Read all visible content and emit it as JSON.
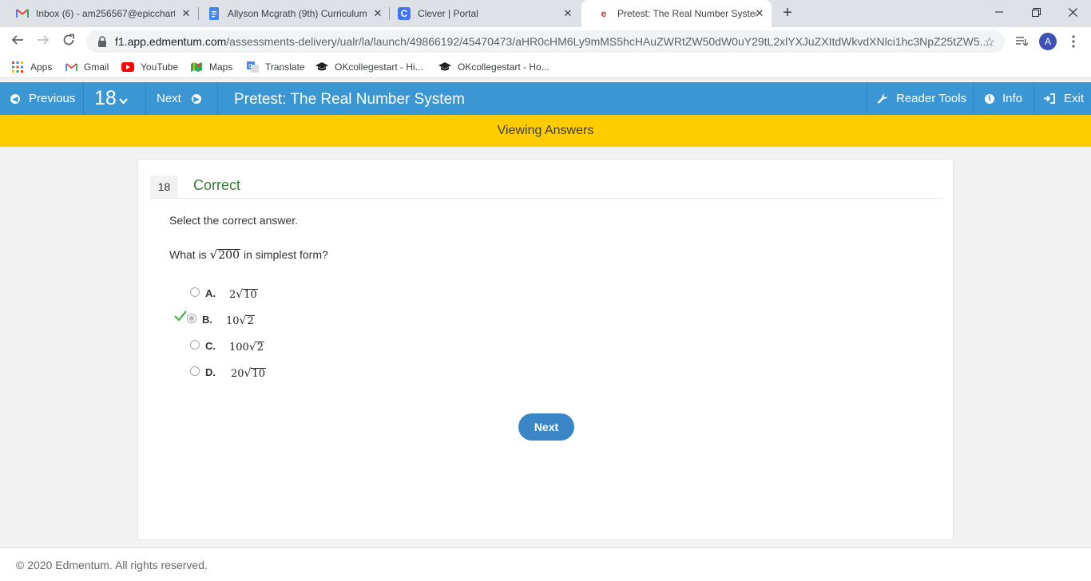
{
  "browser": {
    "tabs": [
      {
        "title": "Inbox (6) - am256567@epiccharte",
        "icon": "gmail-icon"
      },
      {
        "title": "Allyson Mcgrath (9th) Curriculum",
        "icon": "docs-icon"
      },
      {
        "title": "Clever | Portal",
        "icon": "clever-icon"
      },
      {
        "title": "Pretest: The Real Number System",
        "icon": "edmentum-icon",
        "active": true
      }
    ],
    "url_host": "f1.app.edmentum.com",
    "url_path": "/assessments-delivery/ualr/la/launch/49866192/45470473/aHR0cHM6Ly9mMS5hcHAuZWRtZW50dW0uY29tL2xlYXJuZXItdWkvdXNlci1hc3NpZ25tZW5...",
    "profile_initial": "A",
    "bookmarks": [
      "Apps",
      "Gmail",
      "YouTube",
      "Maps",
      "Translate",
      "OKcollegestart - Hi...",
      "OKcollegestart - Ho..."
    ]
  },
  "header": {
    "previous_label": "Previous",
    "question_number": "18",
    "next_label": "Next",
    "title": "Pretest: The Real Number System",
    "reader_tools_label": "Reader Tools",
    "info_label": "Info",
    "exit_label": "Exit"
  },
  "banner": "Viewing Answers",
  "question": {
    "number": "18",
    "status": "Correct",
    "instruction": "Select the correct answer.",
    "prompt_before": "What is",
    "prompt_radicand": "200",
    "prompt_after": "in simplest form?",
    "options": [
      {
        "letter": "A.",
        "coef": "2",
        "radicand": "10",
        "selected": false
      },
      {
        "letter": "B.",
        "coef": "10",
        "radicand": "2",
        "selected": true,
        "correct": true
      },
      {
        "letter": "C.",
        "coef": "100",
        "radicand": "2",
        "selected": false
      },
      {
        "letter": "D.",
        "coef": "20",
        "radicand": "10",
        "selected": false
      }
    ],
    "next_button": "Next"
  },
  "footer": "© 2020 Edmentum. All rights reserved.",
  "colors": {
    "header_blue": "#3b97d3",
    "banner_yellow": "#ffcc00",
    "correct_green": "#3a7a3a",
    "check_green": "#4caf50"
  }
}
